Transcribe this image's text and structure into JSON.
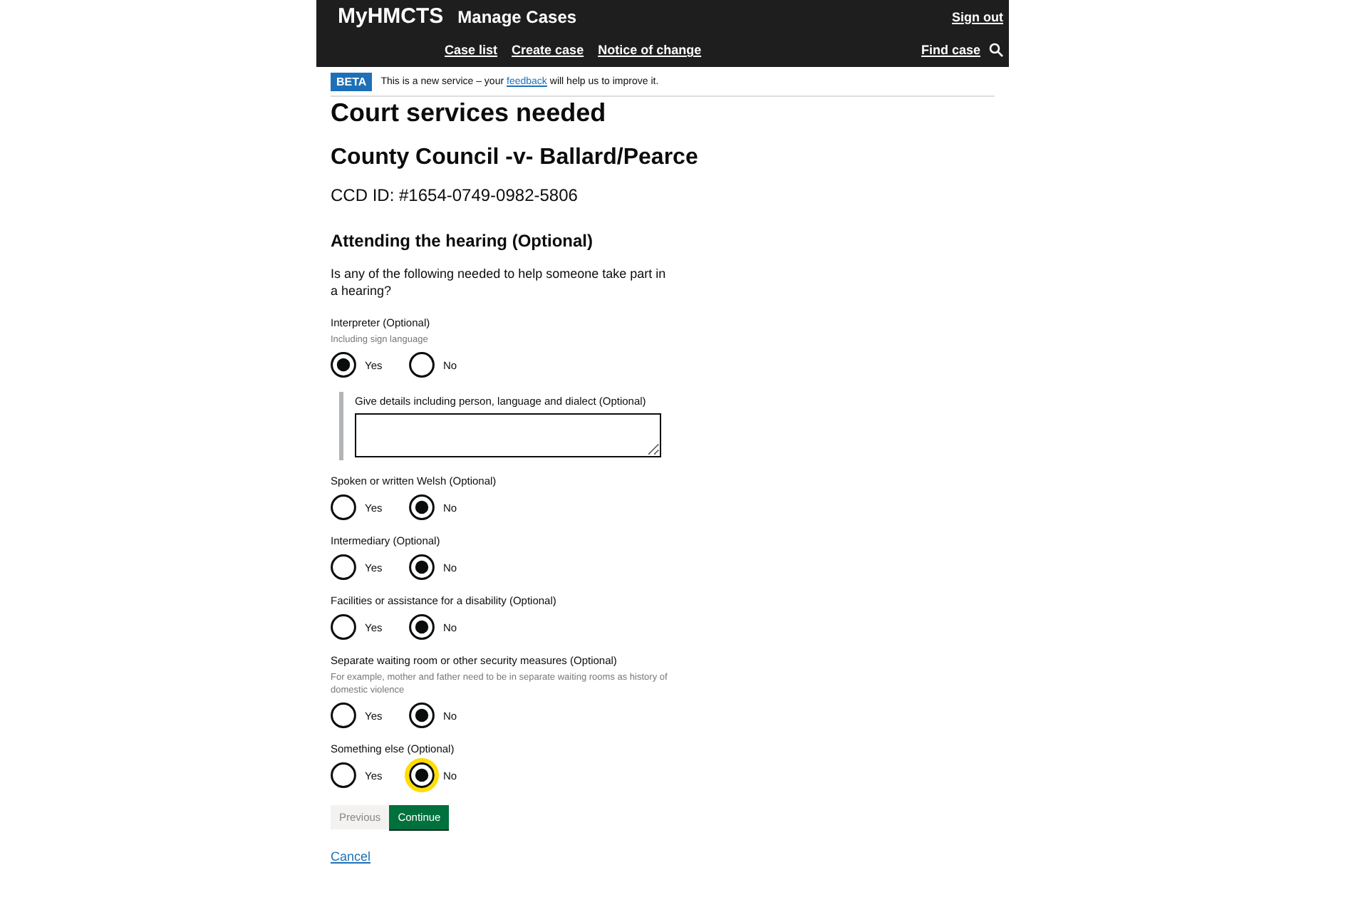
{
  "header": {
    "logo": "MyHMCTS",
    "service": "Manage Cases",
    "sign_out": "Sign out",
    "nav": [
      "Case list",
      "Create case",
      "Notice of change"
    ],
    "find_case": "Find case"
  },
  "banner": {
    "tag": "BETA",
    "text_before": "This is a new service – your",
    "link": "feedback",
    "text_after": "will help us to improve it."
  },
  "page_title": "Court services needed",
  "case_title": "County Council -v- Ballard/Pearce",
  "case_id": "CCD ID: #1654-0749-0982-5806",
  "section_title": "Attending the hearing (Optional)",
  "intro": "Is any of the following needed to help someone take part in a hearing?",
  "questions": [
    {
      "label": "Interpreter (Optional)",
      "hint": "Including sign language",
      "options": [
        {
          "label": "Yes",
          "selected": true,
          "focused": false
        },
        {
          "label": "No",
          "selected": false,
          "focused": false
        }
      ],
      "details": {
        "label": "Give details including person, language and dialect (Optional)"
      }
    },
    {
      "label": "Spoken or written Welsh (Optional)",
      "options": [
        {
          "label": "Yes",
          "selected": false,
          "focused": false
        },
        {
          "label": "No",
          "selected": true,
          "focused": false
        }
      ]
    },
    {
      "label": "Intermediary (Optional)",
      "options": [
        {
          "label": "Yes",
          "selected": false,
          "focused": false
        },
        {
          "label": "No",
          "selected": true,
          "focused": false
        }
      ]
    },
    {
      "label": "Facilities or assistance for a disability (Optional)",
      "options": [
        {
          "label": "Yes",
          "selected": false,
          "focused": false
        },
        {
          "label": "No",
          "selected": true,
          "focused": false
        }
      ]
    },
    {
      "label": "Separate waiting room or other security measures (Optional)",
      "hint": "For example, mother and father need to be in separate waiting rooms as history of domestic violence",
      "options": [
        {
          "label": "Yes",
          "selected": false,
          "focused": false
        },
        {
          "label": "No",
          "selected": true,
          "focused": false
        }
      ]
    },
    {
      "label": "Something else (Optional)",
      "options": [
        {
          "label": "Yes",
          "selected": false,
          "focused": false
        },
        {
          "label": "No",
          "selected": true,
          "focused": true
        }
      ]
    }
  ],
  "buttons": {
    "previous": "Previous",
    "continue": "Continue"
  },
  "cancel": "Cancel"
}
